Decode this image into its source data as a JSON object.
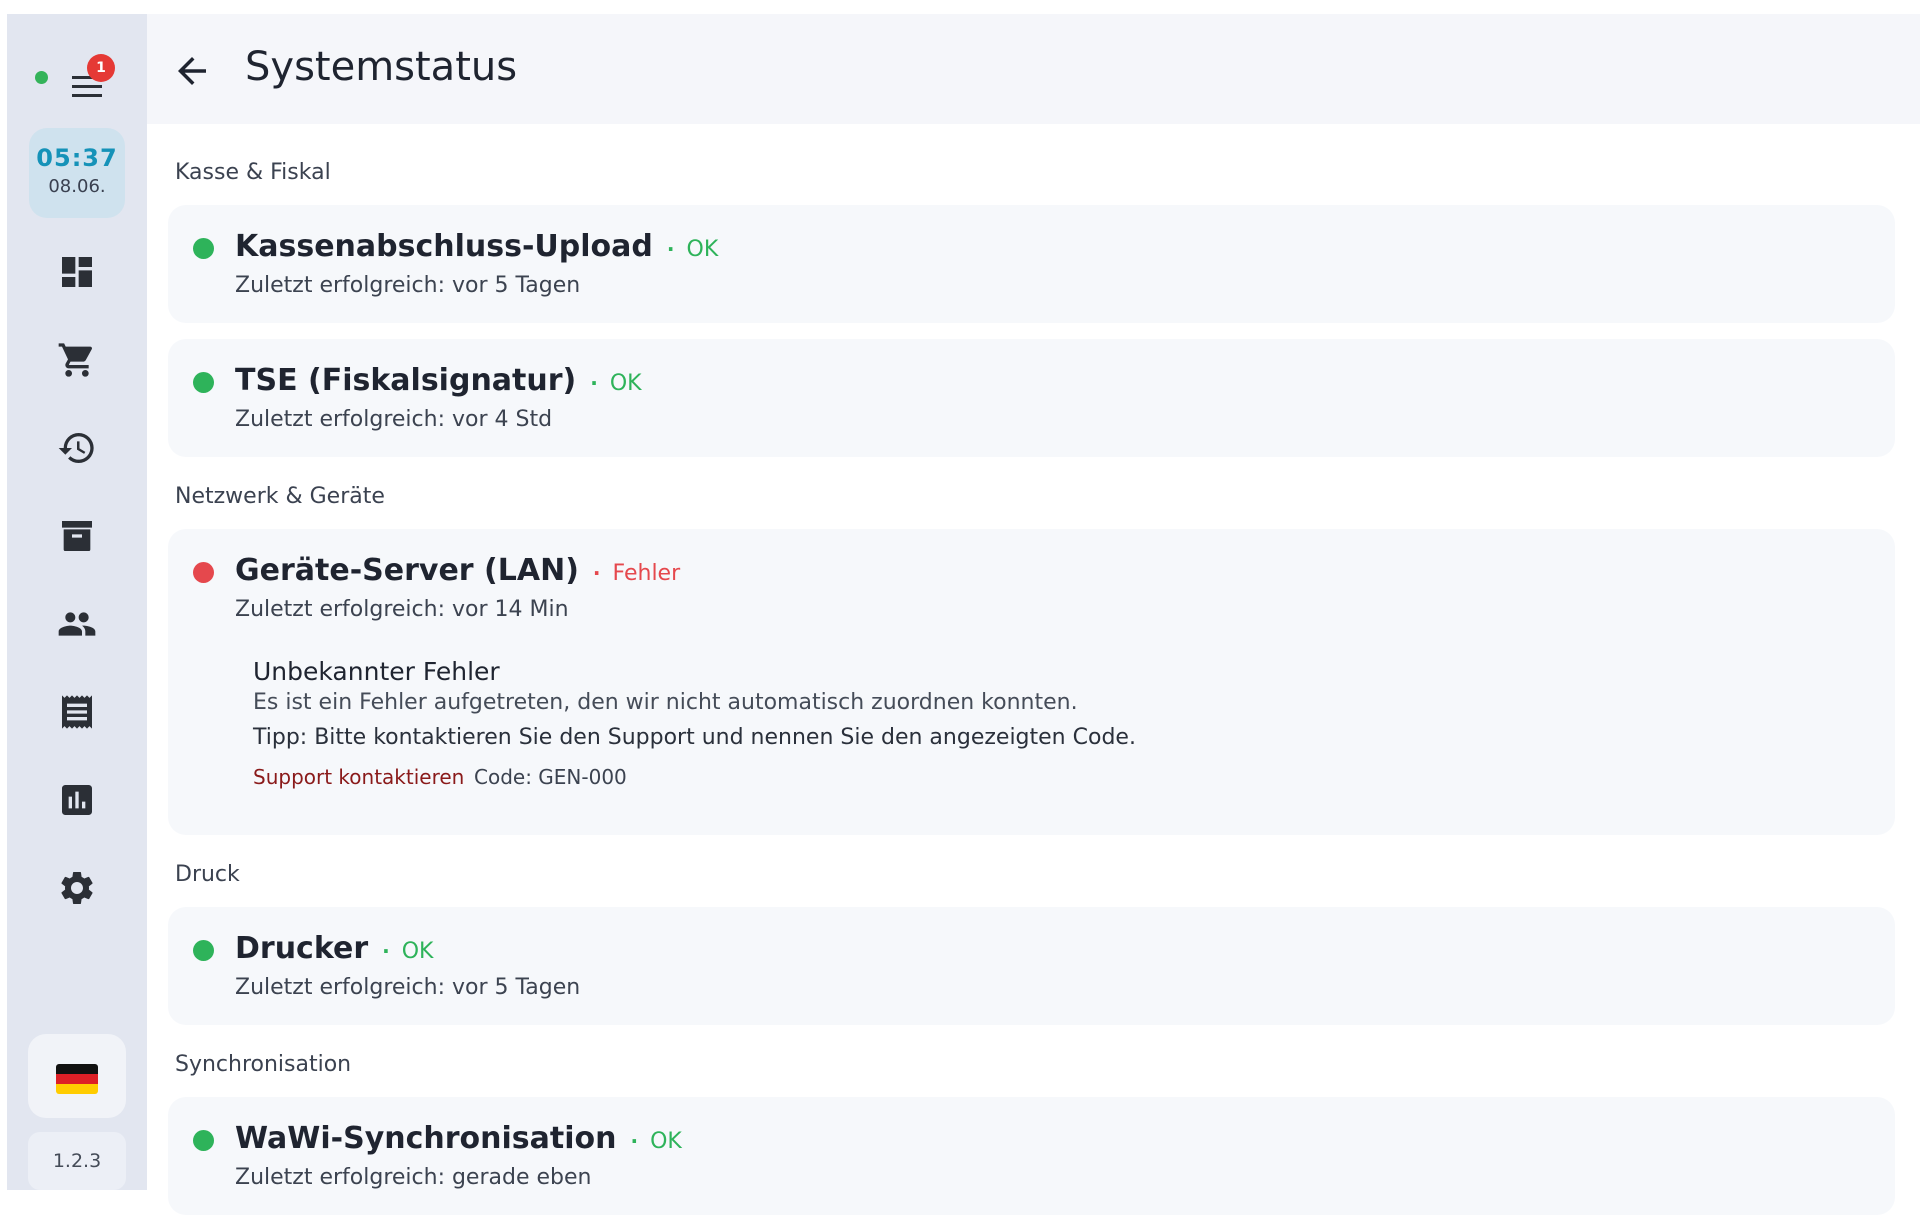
{
  "colors": {
    "ok": "#2eb35a",
    "error": "#e5484d",
    "accent": "#1592b8",
    "sidebar_bg": "#e2e6f0"
  },
  "sidebar": {
    "online_indicator": "online",
    "menu_badge": "1",
    "clock": {
      "time": "05:37",
      "date": "08.06."
    },
    "nav_items": [
      {
        "icon": "dashboard-icon"
      },
      {
        "icon": "cart-icon"
      },
      {
        "icon": "history-icon"
      },
      {
        "icon": "archive-icon"
      },
      {
        "icon": "people-icon"
      },
      {
        "icon": "receipt-icon"
      },
      {
        "icon": "analytics-icon"
      },
      {
        "icon": "settings-icon"
      }
    ],
    "language_flag": "de-flag-icon",
    "version": "1.2.3"
  },
  "header": {
    "back_icon": "arrow-back-icon",
    "title": "Systemstatus"
  },
  "sections": [
    {
      "title": "Kasse & Fiskal",
      "items": [
        {
          "name": "Kassenabschluss-Upload",
          "separator": "·",
          "status": "OK",
          "state": "ok",
          "last_success": "Zuletzt erfolgreich: vor 5 Tagen"
        },
        {
          "name": "TSE (Fiskalsignatur)",
          "separator": "·",
          "status": "OK",
          "state": "ok",
          "last_success": "Zuletzt erfolgreich: vor 4 Std"
        }
      ]
    },
    {
      "title": "Netzwerk & Geräte",
      "items": [
        {
          "name": "Geräte-Server (LAN)",
          "separator": "·",
          "status": "Fehler",
          "state": "error",
          "last_success": "Zuletzt erfolgreich: vor 14 Min",
          "error": {
            "title": "Unbekannter Fehler",
            "text": "Es ist ein Fehler aufgetreten, den wir nicht automatisch zuordnen konnten.",
            "tip": "Tipp: Bitte kontaktieren Sie den Support und nennen Sie den angezeigten Code.",
            "support_link": "Support kontaktieren",
            "code": "Code: GEN-000"
          }
        }
      ]
    },
    {
      "title": "Druck",
      "items": [
        {
          "name": "Drucker",
          "separator": "·",
          "status": "OK",
          "state": "ok",
          "last_success": "Zuletzt erfolgreich: vor 5 Tagen"
        }
      ]
    },
    {
      "title": "Synchronisation",
      "items": [
        {
          "name": "WaWi-Synchronisation",
          "separator": "·",
          "status": "OK",
          "state": "ok",
          "last_success": "Zuletzt erfolgreich: gerade eben"
        }
      ]
    }
  ]
}
